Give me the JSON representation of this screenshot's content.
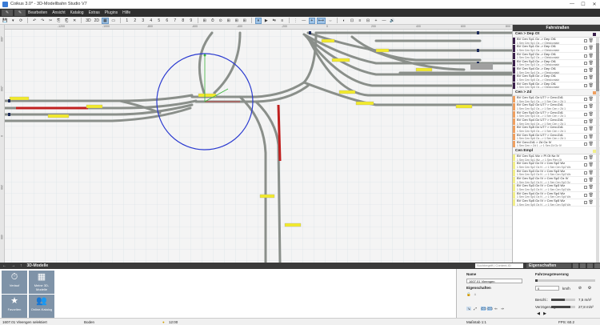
{
  "window": {
    "title": "Coikus 3.0* - 3D-Modellbahn Studio V7",
    "min_icon": "minimize-icon",
    "max_icon": "maximize-icon",
    "close_icon": "close-icon"
  },
  "menu": {
    "mode_buttons": [
      "✎",
      "✎"
    ],
    "items": [
      "Bearbeiten",
      "Ansicht",
      "Katalog",
      "Extras",
      "Plugins",
      "Hilfe"
    ]
  },
  "toolbar": {
    "buttons": [
      "💾",
      "▾",
      "⟳",
      "↶",
      "↷",
      "✂",
      "⎘",
      "⎗",
      "✕",
      "3D",
      "2D",
      "▦",
      "▭",
      "1",
      "2",
      "3",
      "4",
      "5",
      "6",
      "7",
      "8",
      "9",
      "⊞",
      "⏱",
      "⊙",
      "⊞",
      "⊞",
      "⊞",
      "⏸",
      "▶",
      "⇆",
      "≡",
      "⋮",
      "—",
      "+",
      "⟷",
      "⇔",
      "◐",
      "⊡",
      "≡",
      "⊟",
      "+",
      "—",
      "🔊"
    ],
    "active_buttons": [
      11,
      28,
      34,
      35
    ]
  },
  "rulers": {
    "top": [
      "-1200",
      "-1000",
      "-800",
      "-600",
      "-400",
      "-200",
      "0",
      "200",
      "400",
      "600",
      "800"
    ],
    "left": [
      "-400",
      "-200",
      "0",
      "200",
      "400"
    ]
  },
  "side_panel": {
    "title": "Fahrstraßen",
    "sections": [
      {
        "name": "Cen > Dep Ot",
        "color": "#3a1f4a",
        "routes": [
          {
            "l1": "BV Cen Sp1 Oz -> Dep Ot1",
            "l2": "1 Sen Cen Sp1 Oz --> Gleiskontakt",
            "color": "#3a1f4a"
          },
          {
            "l1": "BV Cen Sp1 Oz -> Dep Ot1",
            "l2": "1 Sen Cen Sp1 Oz --> Gleiskontakt",
            "color": "#3a1f4a"
          },
          {
            "l1": "BV Cen Sp2 Oz -> Dep Ot1",
            "l2": "1 Sen Cen Sp2 Oz --> Gleiskontakt",
            "color": "#3a1f4a"
          },
          {
            "l1": "BV Cen Sp3 Oz -> Dep Ot1",
            "l2": "1 Sen Cen Sp3 Oz --> Gleiskontakt",
            "color": "#3a1f4a"
          },
          {
            "l1": "BV Cen Sp4 Oz -> Dep Ot1",
            "l2": "1 Sen Cen Sp4 Oz --> Gleiskontakt",
            "color": "#3a1f4a"
          },
          {
            "l1": "BV Cen Sp5 Oz -> Dep Ot1",
            "l2": "1 Sen Cen Sp5 Oz --> Gleiskontakt",
            "color": "#3a1f4a"
          },
          {
            "l1": "BV Cen Sp6 Oz -> Dep Ot1",
            "l2": "1 Sen Cen Sp6 Oz --> Gleiskontakt",
            "color": "#3a1f4a"
          }
        ]
      },
      {
        "name": "Cen > Zd",
        "color": "#f0a060",
        "routes": [
          {
            "l1": "BV Cen Sp1 Oz UT? > Cen>Zd1",
            "l2": "1 Sen Cen Sp1 Oz --> 1 Sen Cen > Zd 1",
            "color": "#f0a060"
          },
          {
            "l1": "BV Cen Sp2 Oz UT? > Cen>Zd1",
            "l2": "1 Sen Cen Sp2 Oz --> 1 Sen Cen > Zd 1",
            "color": "#f0a060"
          },
          {
            "l1": "BV Cen Sp3 Oz UT? > Cen>Zd1",
            "l2": "1 Sen Cen Sp3 Oz --> 1 Sen Cen > Zd 1",
            "color": "#f0a060"
          },
          {
            "l1": "BV Cen Sp4 Oz UT? > Cen>Zd1",
            "l2": "1 Sen Cen Sp4 Oz --> 1 Sen Cen > Zd 1",
            "color": "#f0a060"
          },
          {
            "l1": "BV Cen Sp5 Oz UT? > Cen>Zd1",
            "l2": "1 Sen Cen Sp5 Oz --> 1 Sen Cen > Zd 1",
            "color": "#f0a060"
          },
          {
            "l1": "BV Cen Sp6 Oz UT? > Cen>Zd1",
            "l2": "1 Sen Cen Sp6 Oz --> 1 Sen Cen > Zd 1",
            "color": "#f0a060"
          },
          {
            "l1": "BV Cen>Zd1 > Zd Oz IV",
            "l2": "1 Sen Cen > Zd 1 --> 1 Sen Zd Oz IV",
            "color": "#f0a060"
          }
        ]
      },
      {
        "name": "Cen Empl",
        "color": "#f2ef8a",
        "routes": [
          {
            "l1": "BV Cen Sp1 Wz > Pl Ot Nz IV",
            "l2": "1 Sen Cen Sp1 Wz --> 1 Sen Plen Ot",
            "color": "#f2ef8a"
          },
          {
            "l1": "BV Cen Sp2 Oz IV > Cen Sp2 Wz",
            "l2": "1 Sen Cen Sp2 Oz IV --> 1 Sen Cen Sp2 Wz",
            "color": "#f2ef8a"
          },
          {
            "l1": "BV Cen Sp3 Oz IV > Cen Sp3 Wz",
            "l2": "1 Sen Cen Sp3 Oz IV --> 1 Sen Cen Sp3 Wz",
            "color": "#f2ef8a"
          },
          {
            "l1": "BV Cen Sp2 Oz IV > Cen Sp2 Oz IV",
            "l2": "1 Sen Cen Sp2 Oz IV --> 1 Sen Cen Sp2 Oz",
            "color": "#f2ef8a"
          },
          {
            "l1": "BV Cen Sp3 Oz IV > Cen Sp3 Wz",
            "l2": "1 Sen Cen Sp3 Oz IV --> 1 Sen Cen Sp3 Wz",
            "color": "#f2ef8a"
          },
          {
            "l1": "BV Cen Sp4 Oz IV > Cen Sp4 Wz",
            "l2": "1 Sen Cen Sp4 Oz IV --> 1 Sen Cen Sp4 Wz",
            "color": "#f2ef8a"
          },
          {
            "l1": "BV Cen Sp5 Oz IV > Cen Sp5 Wz",
            "l2": "1 Sen Cen Sp5 Oz IV --> 1 Sen Cen Sp5 Wz",
            "color": "#f2ef8a"
          }
        ]
      }
    ]
  },
  "bottom_bar": {
    "nav": [
      "←",
      "→",
      "↑"
    ],
    "catalog_title": "3D-Modelle",
    "search_placeholder": "Suchbegriff | Content-ID",
    "properties_tab": "Eigenschaften"
  },
  "catalog": {
    "tiles": [
      {
        "icon": "⏱",
        "label": "Verlauf"
      },
      {
        "icon": "▦",
        "label": "Meine 3D-Modelle"
      },
      {
        "icon": "★",
        "label": "Favoriten"
      },
      {
        "icon": "👥",
        "label": "Online-Katalog"
      }
    ]
  },
  "properties": {
    "name_label": "Name",
    "name_value": "1607.01 Vleengen",
    "eig_label": "Eigenschaften",
    "control_title": "Fahrzeugsteuerung",
    "speed_value": "0",
    "speed_unit": "km/h",
    "accel_label": "Beschl.:",
    "accel_value": "7,5 m/s²",
    "accel_fraction": 0.55,
    "decel_label": "Verzögerung:",
    "decel_value": "27,8 m/s²",
    "decel_fraction": 0.8
  },
  "status": {
    "selection": "1607.01 Vleengen selektiert",
    "layer": "Boden",
    "time": "12:00",
    "scale": "Maßstab 1:1",
    "fps": "FPS: 60.2"
  }
}
